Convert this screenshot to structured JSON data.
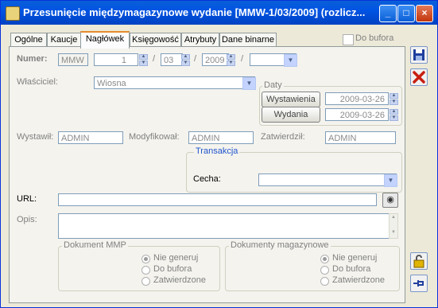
{
  "window": {
    "title": "Przesunięcie międzymagazynowe wydanie [MMW-1/03/2009] (rozlicz..."
  },
  "tabs": [
    "Ogólne",
    "Kaucje",
    "Nagłówek",
    "Księgowość",
    "Atrybuty",
    "Dane binarne"
  ],
  "active_tab": "Nagłówek",
  "do_bufora": "Do bufora",
  "numer": {
    "label": "Numer:",
    "prefix": "MMW",
    "num": "1",
    "sep1": "/",
    "month": "03",
    "sep2": "/",
    "year": "2009",
    "sep3": "/",
    "extra": ""
  },
  "wlasciciel": {
    "label": "Właściciel:",
    "value": "Wiosna"
  },
  "daty": {
    "title": "Daty",
    "wystawienia_btn": "Wystawienia",
    "wystawienia_value": "2009-03-26",
    "wydania_btn": "Wydania",
    "wydania_value": "2009-03-26"
  },
  "people": {
    "wystawil_label": "Wystawił:",
    "wystawil": "ADMIN",
    "modyfikowal_label": "Modyfikował:",
    "modyfikowal": "ADMIN",
    "zatwierdzil_label": "Zatwierdził:",
    "zatwierdzil": "ADMIN"
  },
  "transakcja": {
    "title": "Transakcja",
    "cecha_label": "Cecha:",
    "cecha_value": ""
  },
  "url": {
    "label": "URL:",
    "value": ""
  },
  "opis": {
    "label": "Opis:",
    "value": ""
  },
  "dokument_mmp": {
    "title": "Dokument MMP",
    "options": [
      "Nie generuj",
      "Do bufora",
      "Zatwierdzone"
    ],
    "selected": 0
  },
  "dokumenty_magazynowe": {
    "title": "Dokumenty magazynowe",
    "options": [
      "Nie generuj",
      "Do bufora",
      "Zatwierdzone"
    ],
    "selected": 0
  },
  "colors": {
    "titlebar": "#0054e3",
    "accent_tab": "#e68b2c"
  },
  "icons": [
    "save-icon",
    "close-icon",
    "lock-icon",
    "pin-icon",
    "globe-search-icon"
  ]
}
